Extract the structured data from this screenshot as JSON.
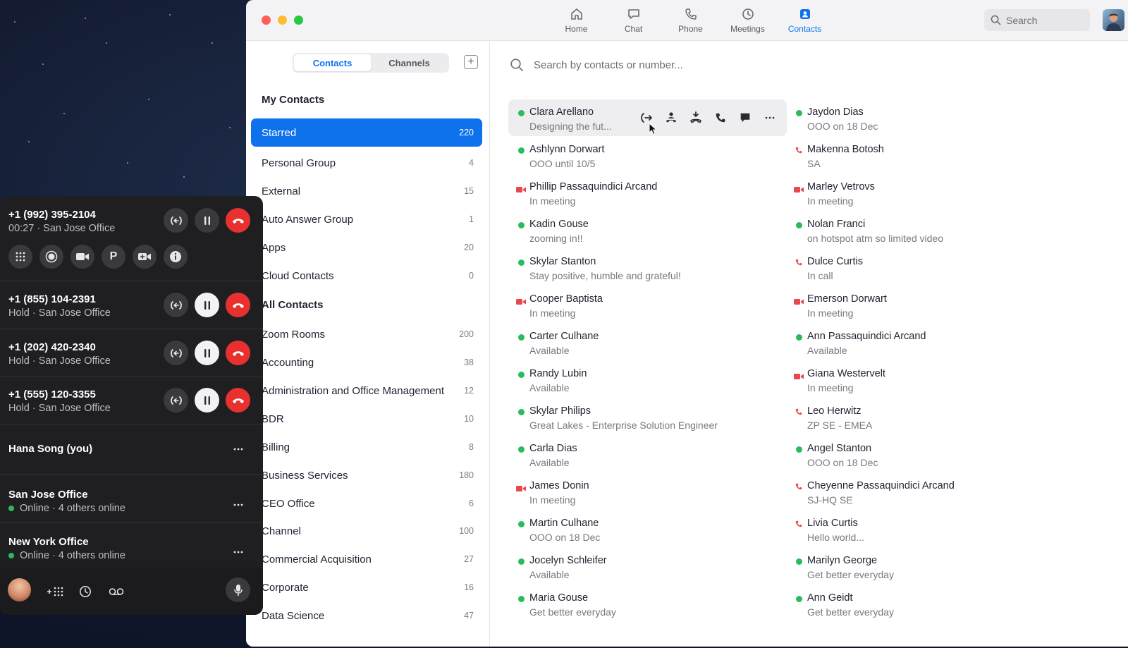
{
  "topnav": {
    "items": [
      {
        "label": "Home",
        "icon": "home-icon"
      },
      {
        "label": "Chat",
        "icon": "chat-icon"
      },
      {
        "label": "Phone",
        "icon": "phone-icon"
      },
      {
        "label": "Meetings",
        "icon": "clock-icon"
      },
      {
        "label": "Contacts",
        "icon": "contacts-icon"
      }
    ],
    "active": "Contacts",
    "search_placeholder": "Search"
  },
  "left_panel": {
    "tabs": [
      "Contacts",
      "Channels"
    ],
    "active_tab": "Contacts",
    "my_contacts_heading": "My Contacts",
    "my_groups": [
      {
        "label": "Starred",
        "count": "220"
      },
      {
        "label": "Personal Group",
        "count": "4"
      },
      {
        "label": "External",
        "count": "15"
      },
      {
        "label": "Auto Answer Group",
        "count": "1"
      },
      {
        "label": "Apps",
        "count": "20"
      },
      {
        "label": "Cloud Contacts",
        "count": "0"
      }
    ],
    "all_contacts_heading": "All Contacts",
    "all_groups": [
      {
        "label": "Zoom Rooms",
        "count": "200"
      },
      {
        "label": "Accounting",
        "count": "38"
      },
      {
        "label": "Administration and Office Management",
        "count": "12"
      },
      {
        "label": "BDR",
        "count": "10"
      },
      {
        "label": "Billing",
        "count": "8"
      },
      {
        "label": "Business Services",
        "count": "180"
      },
      {
        "label": "CEO Office",
        "count": "6"
      },
      {
        "label": "Channel",
        "count": "100"
      },
      {
        "label": "Commercial Acquisition",
        "count": "27"
      },
      {
        "label": "Corporate",
        "count": "16"
      },
      {
        "label": "Data Science",
        "count": "47"
      }
    ]
  },
  "contacts": {
    "search_placeholder": "Search by contacts or number...",
    "column_left": [
      {
        "name": "Clara Arellano",
        "status": "Designing the fut...",
        "presence": "available"
      },
      {
        "name": "Ashlynn Dorwart",
        "status": "OOO until 10/5",
        "presence": "available"
      },
      {
        "name": "Phillip Passaquindici Arcand",
        "status": "In meeting",
        "presence": "meeting"
      },
      {
        "name": "Kadin Gouse",
        "status": "zooming in!!",
        "presence": "available"
      },
      {
        "name": "Skylar Stanton",
        "status": "Stay positive, humble and grateful!",
        "presence": "available"
      },
      {
        "name": "Cooper Baptista",
        "status": "In meeting",
        "presence": "meeting"
      },
      {
        "name": "Carter Culhane",
        "status": "Available",
        "presence": "available"
      },
      {
        "name": "Randy Lubin",
        "status": "Available",
        "presence": "available"
      },
      {
        "name": "Skylar Philips",
        "status": "Great Lakes - Enterprise Solution Engineer",
        "presence": "available"
      },
      {
        "name": "Carla Dias",
        "status": "Available",
        "presence": "available"
      },
      {
        "name": "James Donin",
        "status": "In meeting",
        "presence": "meeting"
      },
      {
        "name": "Martin Culhane",
        "status": "OOO on 18 Dec",
        "presence": "available"
      },
      {
        "name": "Jocelyn Schleifer",
        "status": "Available",
        "presence": "available"
      },
      {
        "name": "Maria Gouse",
        "status": "Get better everyday",
        "presence": "available"
      }
    ],
    "column_right": [
      {
        "name": "Jaydon Dias",
        "status": "OOO on 18 Dec",
        "presence": "available"
      },
      {
        "name": "Makenna Botosh",
        "status": "SA",
        "presence": "call"
      },
      {
        "name": "Marley Vetrovs",
        "status": "In meeting",
        "presence": "meeting"
      },
      {
        "name": "Nolan Franci",
        "status": "on hotspot atm so limited video",
        "presence": "available"
      },
      {
        "name": "Dulce Curtis",
        "status": "In call",
        "presence": "call"
      },
      {
        "name": "Emerson Dorwart",
        "status": "In meeting",
        "presence": "meeting"
      },
      {
        "name": "Ann Passaquindici Arcand",
        "status": "Available",
        "presence": "available"
      },
      {
        "name": "Giana Westervelt",
        "status": "In meeting",
        "presence": "meeting"
      },
      {
        "name": "Leo Herwitz",
        "status": "ZP SE - EMEA",
        "presence": "call"
      },
      {
        "name": "Angel Stanton",
        "status": "OOO on 18 Dec",
        "presence": "available"
      },
      {
        "name": "Cheyenne Passaquindici Arcand",
        "status": "SJ-HQ SE",
        "presence": "call"
      },
      {
        "name": "Livia Curtis",
        "status": "Hello world...",
        "presence": "call"
      },
      {
        "name": "Marilyn George",
        "status": "Get better everyday",
        "presence": "available"
      },
      {
        "name": "Ann Geidt",
        "status": "Get better everyday",
        "presence": "available"
      }
    ],
    "quick_actions": [
      "transfer-icon",
      "warm-transfer-icon",
      "conference-icon",
      "call-icon",
      "message-icon",
      "more-icon"
    ]
  },
  "calls": {
    "active": {
      "number": "+1 (992) 395-2104",
      "sub": "00:27 · San Jose Office"
    },
    "tools": [
      "keypad-icon",
      "record-icon",
      "video-icon",
      "park-icon",
      "meeting-icon",
      "info-icon"
    ],
    "held": [
      {
        "number": "+1 (855) 104-2391",
        "sub": "Hold · San Jose Office"
      },
      {
        "number": "+1 (202) 420-2340",
        "sub": "Hold · San Jose Office"
      },
      {
        "number": "+1 (555) 120-3355",
        "sub": "Hold · San Jose Office"
      }
    ],
    "lines": [
      {
        "name": "Hana Song (you)",
        "sub": ""
      },
      {
        "name": "San Jose Office",
        "sub": "Online · 4 others online"
      },
      {
        "name": "New York Office",
        "sub": "Online · 4 others online"
      }
    ]
  },
  "colors": {
    "accent": "#0e72ed",
    "hangup": "#e8312f",
    "online": "#2bbb5b",
    "meeting": "#e8484c"
  }
}
